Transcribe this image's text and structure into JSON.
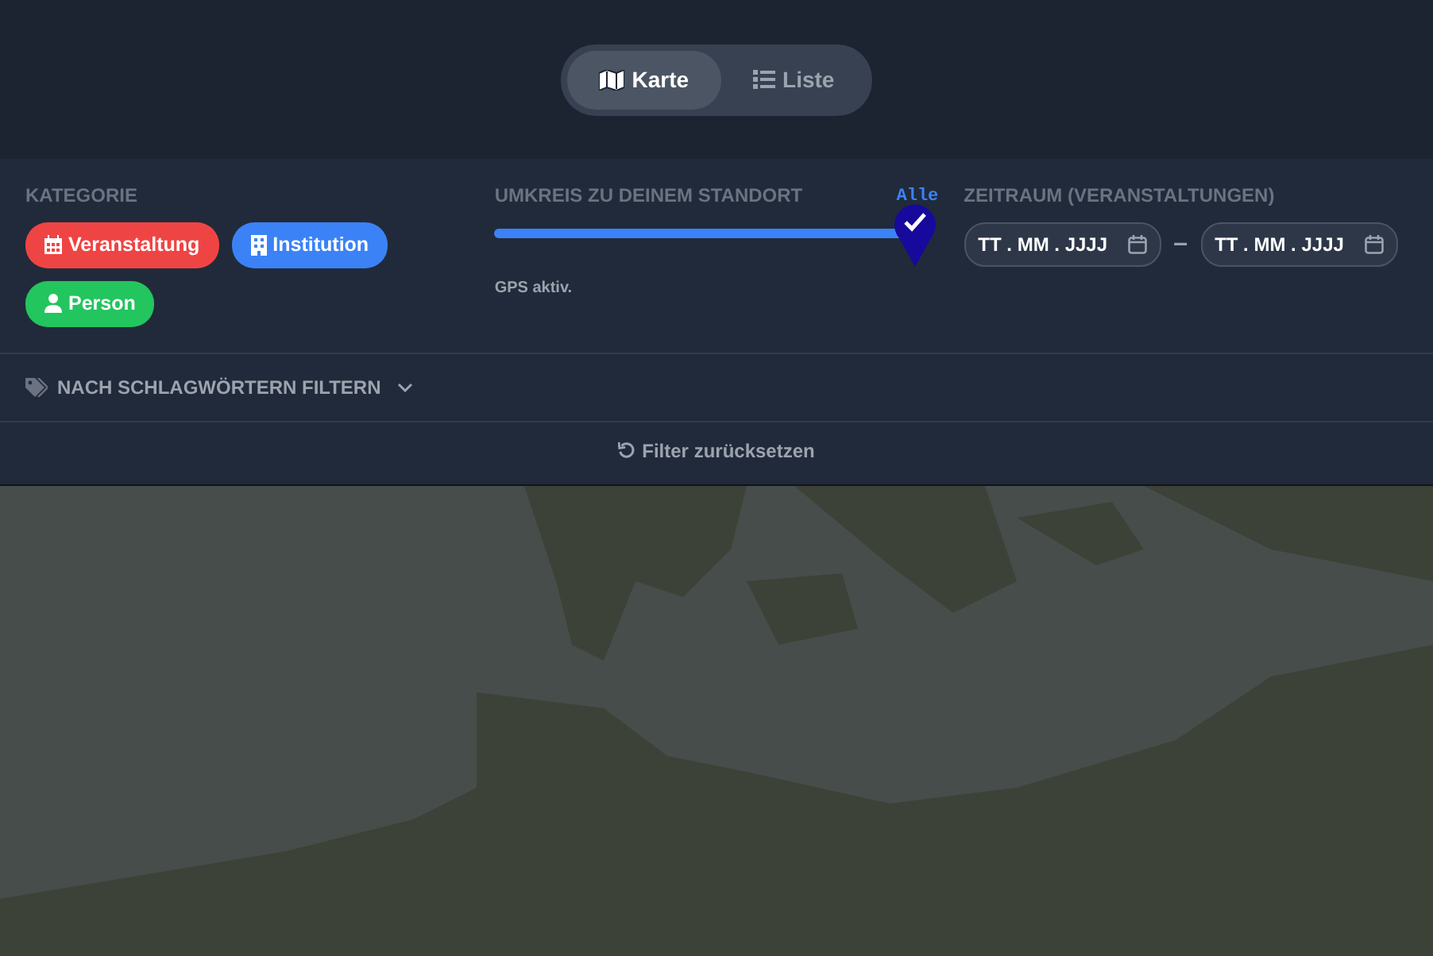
{
  "view_toggle": [
    {
      "label": "Karte",
      "kind": "map",
      "selected": true
    },
    {
      "label": "Liste",
      "kind": "list",
      "selected": false
    }
  ],
  "category": {
    "title": "KATEGORIE",
    "chips": [
      {
        "label": "Veranstaltung",
        "kind": "event",
        "color": "#ef4444"
      },
      {
        "label": "Institution",
        "kind": "institution",
        "color": "#3b82f6"
      },
      {
        "label": "Person",
        "kind": "person",
        "color": "#22c55e"
      }
    ]
  },
  "radius": {
    "title": "UMKREIS ZU DEINEM STANDORT",
    "reading": "Alle",
    "level": 1,
    "status": "GPS aktiv."
  },
  "period": {
    "title": "ZEITRAUM (VERANSTALTUNGEN)",
    "from": "TT . MM . JJJJ",
    "separator": "–",
    "to": "TT . MM . JJJJ"
  },
  "tags_filter": {
    "label": "NACH SCHLAGWÖRTERN FILTERN",
    "expanded": false
  },
  "reset": {
    "label": "Filter zurücksetzen"
  }
}
